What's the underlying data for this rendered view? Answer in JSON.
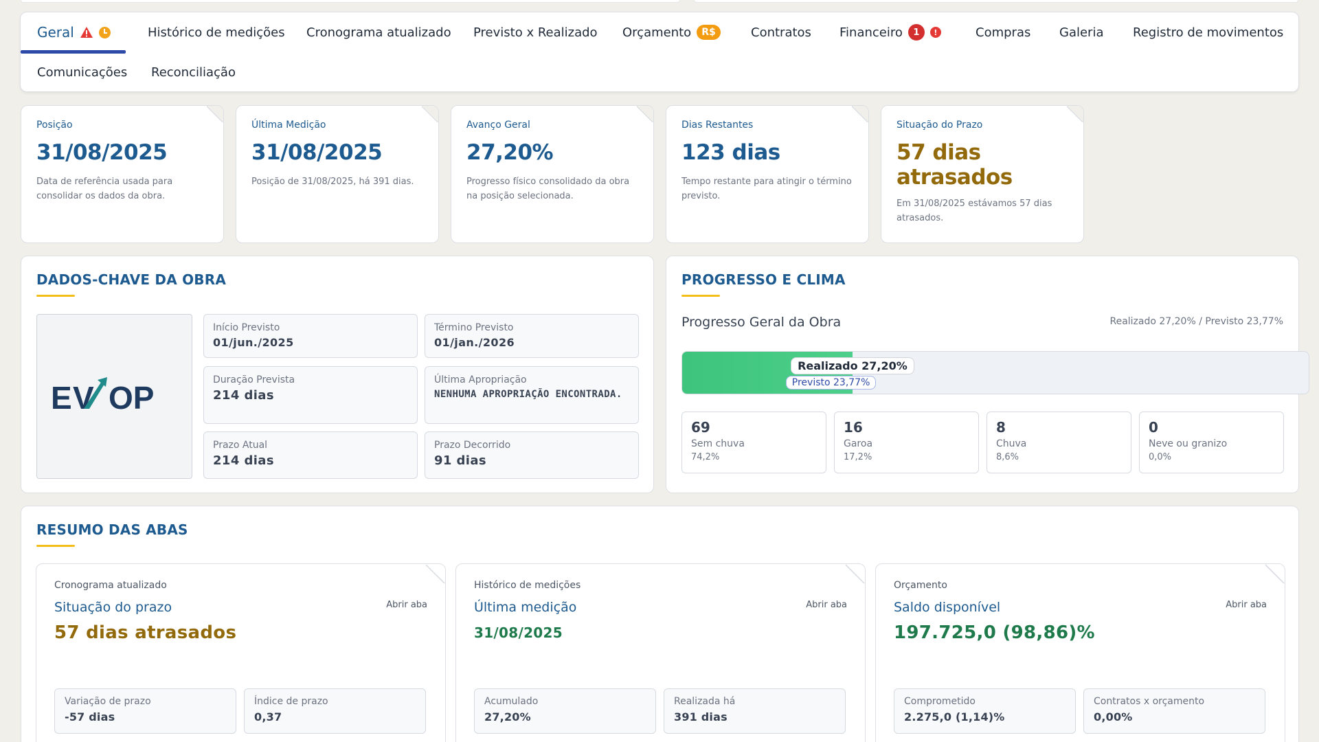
{
  "tabs": [
    {
      "label": "Geral"
    },
    {
      "label": "Histórico de medições"
    },
    {
      "label": "Cronograma atualizado"
    },
    {
      "label": "Previsto x Realizado"
    },
    {
      "label": "Orçamento",
      "badge": "R$"
    },
    {
      "label": "Contratos"
    },
    {
      "label": "Financeiro",
      "count": "1"
    },
    {
      "label": "Compras"
    },
    {
      "label": "Galeria"
    },
    {
      "label": "Registro de movimentos"
    },
    {
      "label": "Comunicações"
    },
    {
      "label": "Reconciliação"
    }
  ],
  "kpis": [
    {
      "label": "Posição",
      "value": "31/08/2025",
      "desc": "Data de referência usada para consolidar os dados da obra."
    },
    {
      "label": "Última Medição",
      "value": "31/08/2025",
      "desc": "Posição de 31/08/2025, há 391 dias."
    },
    {
      "label": "Avanço Geral",
      "value": "27,20%",
      "desc": "Progresso físico consolidado da obra na posição selecionada."
    },
    {
      "label": "Dias Restantes",
      "value": "123 dias",
      "desc": "Tempo restante para atingir o término previsto."
    },
    {
      "label": "Situação do Prazo",
      "value": "57 dias atrasados",
      "desc": "Em 31/08/2025 estávamos 57 dias atrasados."
    }
  ],
  "dados": {
    "title": "DADOS-CHAVE DA OBRA",
    "logo_text": "EVOP",
    "fields": [
      {
        "label": "Início Previsto",
        "value": "01/jun./2025"
      },
      {
        "label": "Término Previsto",
        "value": "01/jan./2026"
      },
      {
        "label": "Duração Prevista",
        "value": "214 dias"
      },
      {
        "label": "Última Apropriação",
        "value": "NENHUMA APROPRIAÇÃO ENCONTRADA."
      },
      {
        "label": "Prazo Atual",
        "value": "214 dias"
      },
      {
        "label": "Prazo Decorrido",
        "value": "91 dias"
      }
    ]
  },
  "progresso": {
    "title": "PROGRESSO E CLIMA",
    "heading": "Progresso Geral da Obra",
    "meta": "Realizado 27,20% / Previsto 23,77%",
    "realizado_label": "Realizado 27,20%",
    "previsto_label": "Previsto 23,77%",
    "realizado_pct": 27.2,
    "previsto_pct": 23.77,
    "clima": [
      {
        "count": "69",
        "name": "Sem chuva",
        "pct": "74,2%"
      },
      {
        "count": "16",
        "name": "Garoa",
        "pct": "17,2%"
      },
      {
        "count": "8",
        "name": "Chuva",
        "pct": "8,6%"
      },
      {
        "count": "0",
        "name": "Neve ou granizo",
        "pct": "0,0%"
      }
    ]
  },
  "resumo": {
    "title": "RESUMO DAS ABAS",
    "cards": [
      {
        "category": "Cronograma atualizado",
        "title": "Situação do prazo",
        "open": "Abrir aba",
        "value": "57 dias atrasados",
        "minis": [
          {
            "label": "Variação de prazo",
            "value": "-57 dias"
          },
          {
            "label": "Índice de prazo",
            "value": "0,37"
          }
        ]
      },
      {
        "category": "Histórico de medições",
        "title": "Última medição",
        "open": "Abrir aba",
        "value": "31/08/2025",
        "minis": [
          {
            "label": "Acumulado",
            "value": "27,20%"
          },
          {
            "label": "Realizada há",
            "value": "391 dias"
          }
        ]
      },
      {
        "category": "Orçamento",
        "title": "Saldo disponível",
        "open": "Abrir aba",
        "value": "197.725,0 (98,86)%",
        "minis": [
          {
            "label": "Comprometido",
            "value": "2.275,0 (1,14)%"
          },
          {
            "label": "Contratos x orçamento",
            "value": "0,00%"
          }
        ]
      }
    ]
  },
  "colors": {
    "primary": "#1d5a8f",
    "accent": "#f3bd1a",
    "late": "#936a0b",
    "good": "#1e7a4a",
    "progress": "#3ec47c"
  }
}
